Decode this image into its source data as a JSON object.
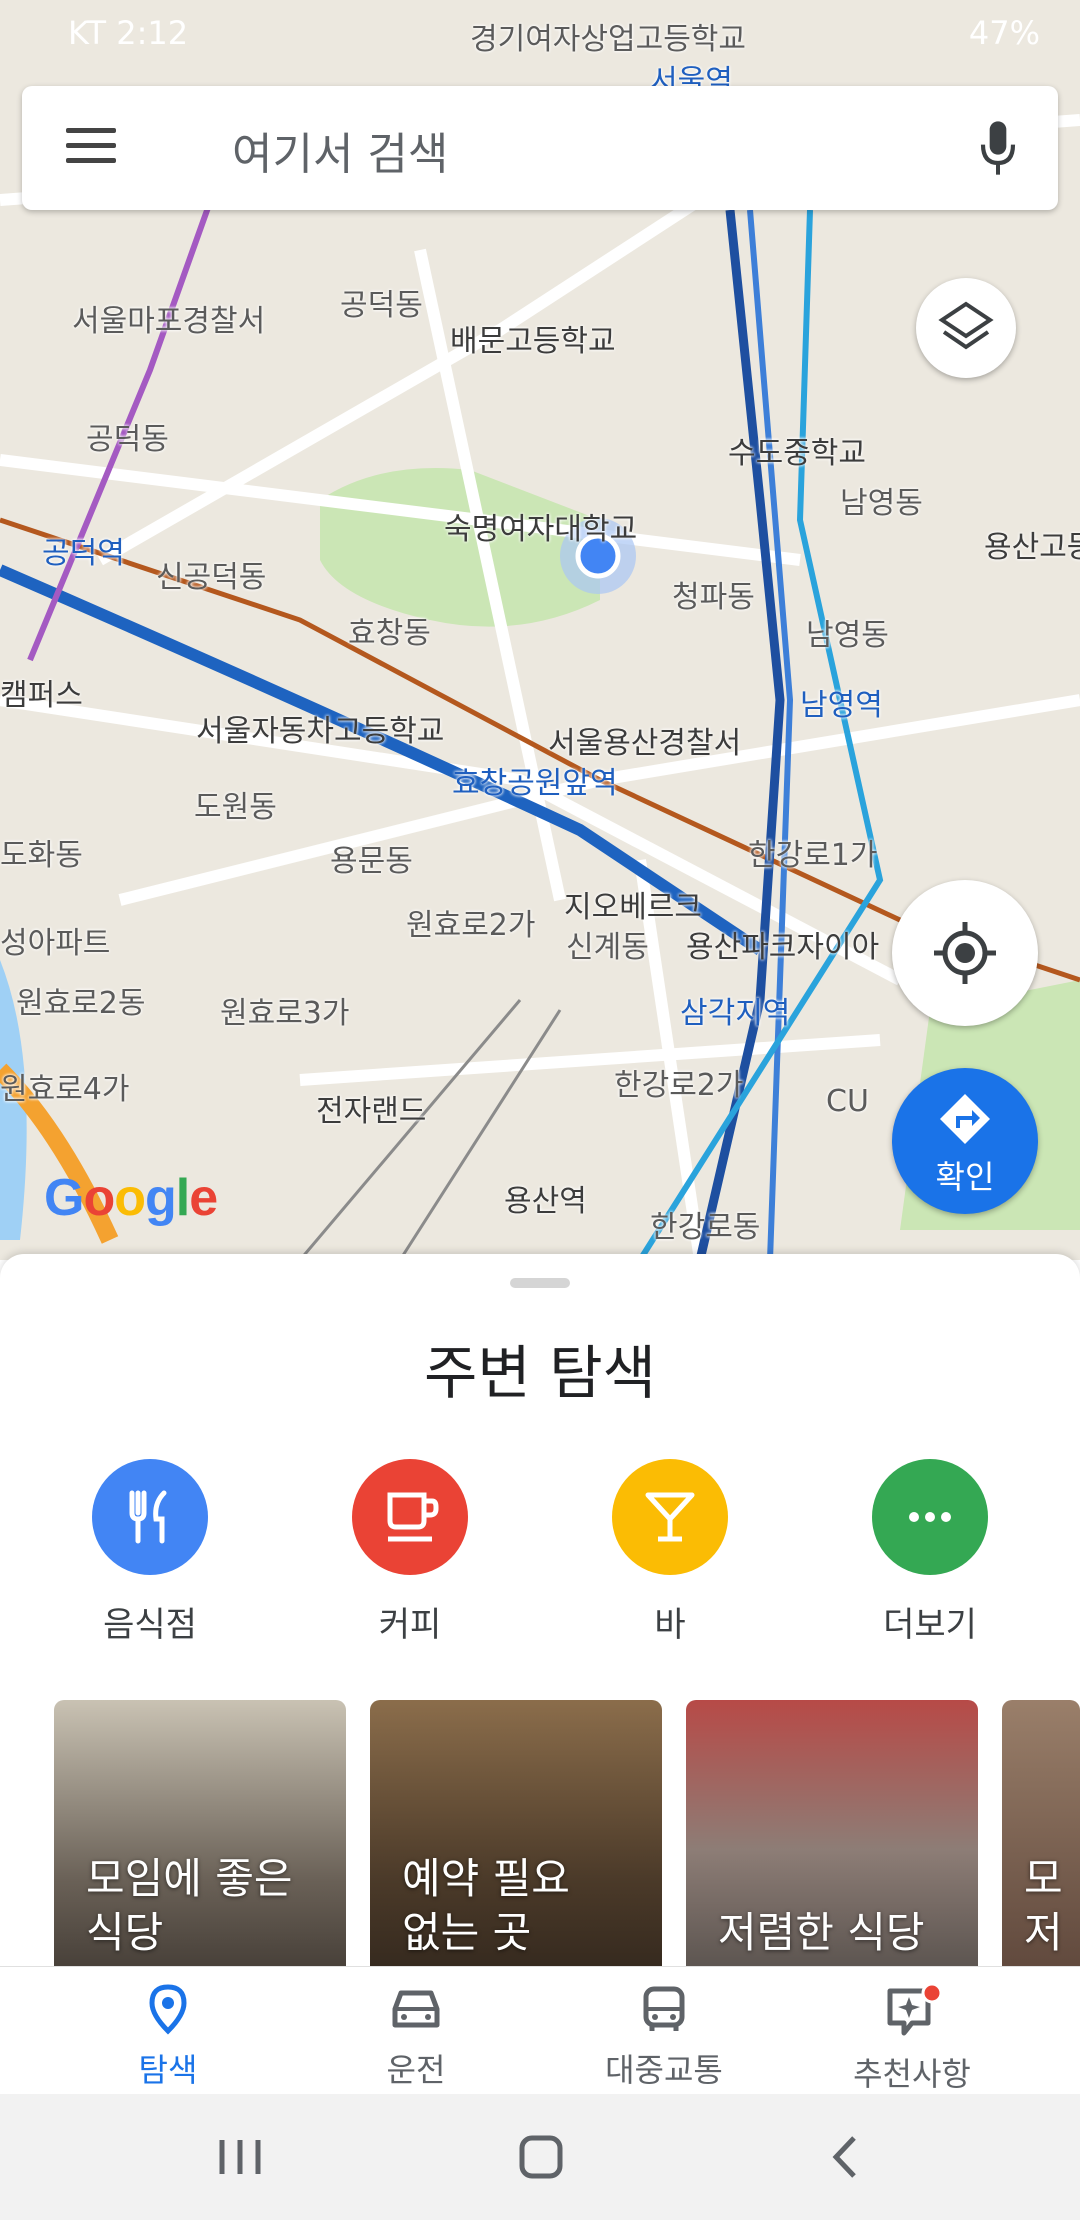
{
  "status_bar": {
    "carrier_time": "KT 2:12",
    "battery": "47%"
  },
  "search": {
    "placeholder": "여기서 검색"
  },
  "map_labels": [
    "경기여자상업고등학교",
    "서울역",
    "공덕동",
    "서울마포경찰서",
    "배문고등학교",
    "공덕동",
    "수도중학교",
    "남영동",
    "용산고등",
    "숙명여자대학교",
    "공덕역",
    "신공덕동",
    "청파동",
    "효창동",
    "남영동",
    "남영역",
    "캠퍼스",
    "서울자동차고등학교",
    "서울용산경찰서",
    "효창공원앞역",
    "도원동",
    "한강로1가",
    "용문동",
    "지오베르크",
    "신계동",
    "용산파크자이아",
    "원효로2가",
    "원효로2동",
    "원효로3가",
    "삼각지역",
    "원효로4가",
    "전자랜드",
    "한강로2가",
    "CU",
    "용산역",
    "한강로동",
    "도화동",
    "성아파트"
  ],
  "map_controls": {
    "directions_label": "확인"
  },
  "map_attribution": "Google",
  "sheet": {
    "title": "주변 탐색",
    "categories": [
      {
        "label": "음식점",
        "icon": "fork-knife-icon",
        "color": "#4285f4"
      },
      {
        "label": "커피",
        "icon": "coffee-icon",
        "color": "#ea4335"
      },
      {
        "label": "바",
        "icon": "cocktail-icon",
        "color": "#fbbc04"
      },
      {
        "label": "더보기",
        "icon": "more-horiz-icon",
        "color": "#34a853"
      }
    ],
    "cards": [
      {
        "line1": "모임에 좋은",
        "line2": "식당"
      },
      {
        "line1": "예약 필요",
        "line2": "없는 곳"
      },
      {
        "line1": "",
        "line2": "저렴한 식당"
      },
      {
        "line1": "모",
        "line2": "저"
      }
    ]
  },
  "bottom_nav": [
    {
      "label": "탐색",
      "icon": "explore-pin-icon",
      "active": true
    },
    {
      "label": "운전",
      "icon": "car-icon",
      "active": false
    },
    {
      "label": "대중교통",
      "icon": "bus-icon",
      "active": false
    },
    {
      "label": "추천사항",
      "icon": "updates-sparkle-icon",
      "active": false
    }
  ],
  "colors": {
    "accent": "#1a73e8",
    "red": "#ea4335",
    "yellow": "#fbbc04",
    "green": "#34a853"
  }
}
